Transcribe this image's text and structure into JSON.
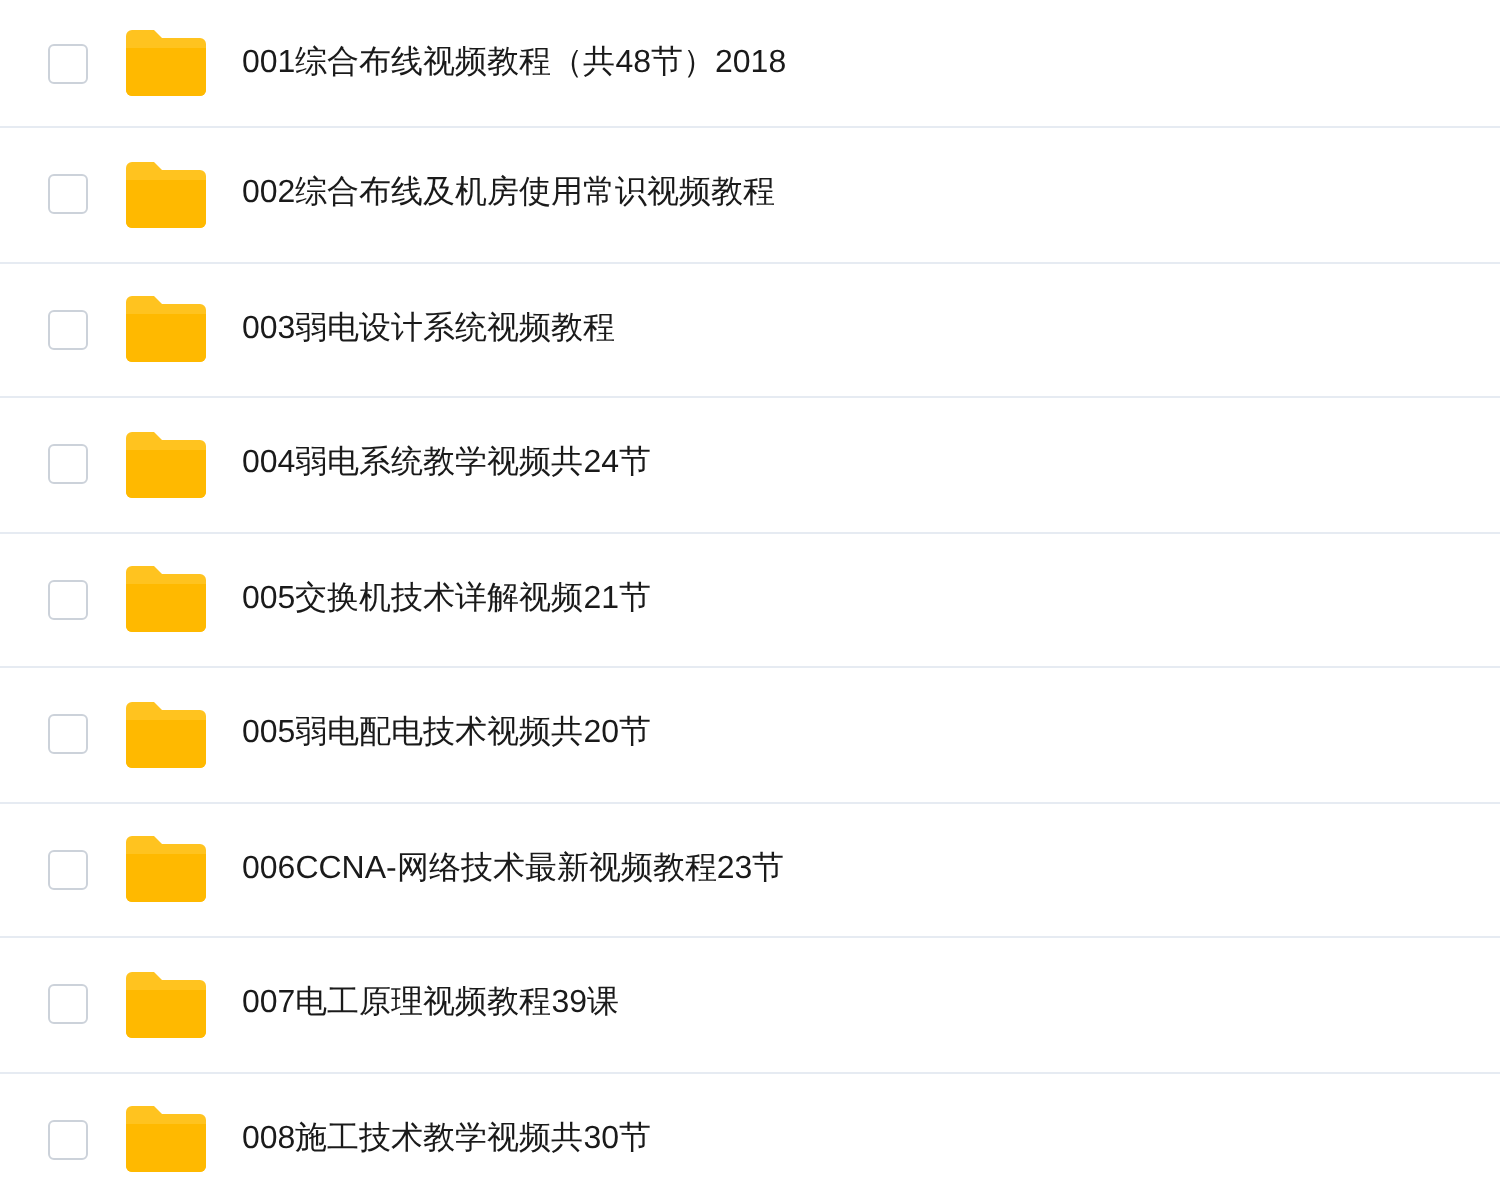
{
  "files": [
    {
      "name": "001综合布线视频教程（共48节）2018",
      "checked": false
    },
    {
      "name": "002综合布线及机房使用常识视频教程",
      "checked": false
    },
    {
      "name": "003弱电设计系统视频教程",
      "checked": false
    },
    {
      "name": "004弱电系统教学视频共24节",
      "checked": false
    },
    {
      "name": "005交换机技术详解视频21节",
      "checked": false
    },
    {
      "name": "005弱电配电技术视频共20节",
      "checked": false
    },
    {
      "name": "006CCNA-网络技术最新视频教程23节",
      "checked": false
    },
    {
      "name": "007电工原理视频教程39课",
      "checked": false
    },
    {
      "name": "008施工技术教学视频共30节",
      "checked": false
    }
  ]
}
